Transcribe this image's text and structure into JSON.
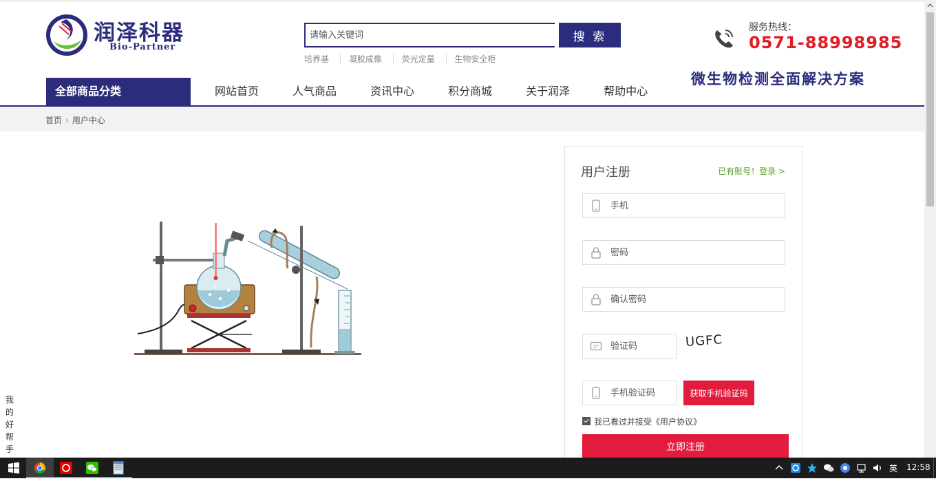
{
  "brand": {
    "name_cn": "润泽科器",
    "name_en": "Bio-Partner",
    "primary_color": "#2b2c7c",
    "accent_color": "#e31b3c"
  },
  "search": {
    "placeholder": "请输入关键词",
    "button": "搜 索",
    "hot_words": [
      "培养基",
      "凝胶成像",
      "荧光定量",
      "生物安全柜"
    ]
  },
  "hotline": {
    "label": "服务热线：",
    "number": "0571-88998985"
  },
  "slogan": "微生物检测全面解决方案",
  "nav": {
    "category": "全部商品分类",
    "items": [
      "网站首页",
      "人气商品",
      "资讯中心",
      "积分商城",
      "关于润泽",
      "帮助中心"
    ]
  },
  "breadcrumb": {
    "home": "首页",
    "sep": "›",
    "current": "用户中心"
  },
  "register": {
    "title": "用户注册",
    "login_link": "已有账号！登录 >",
    "phone_placeholder": "手机",
    "password_placeholder": "密码",
    "confirm_placeholder": "确认密码",
    "captcha_placeholder": "验证码",
    "captcha_text": "UGFC",
    "sms_placeholder": "手机验证码",
    "sms_button": "获取手机验证码",
    "agree_text": "我已看过并接受《用户协议》",
    "submit": "立即注册"
  },
  "helper": "我的好帮手",
  "taskbar": {
    "ime": "英",
    "time": "12:58"
  }
}
